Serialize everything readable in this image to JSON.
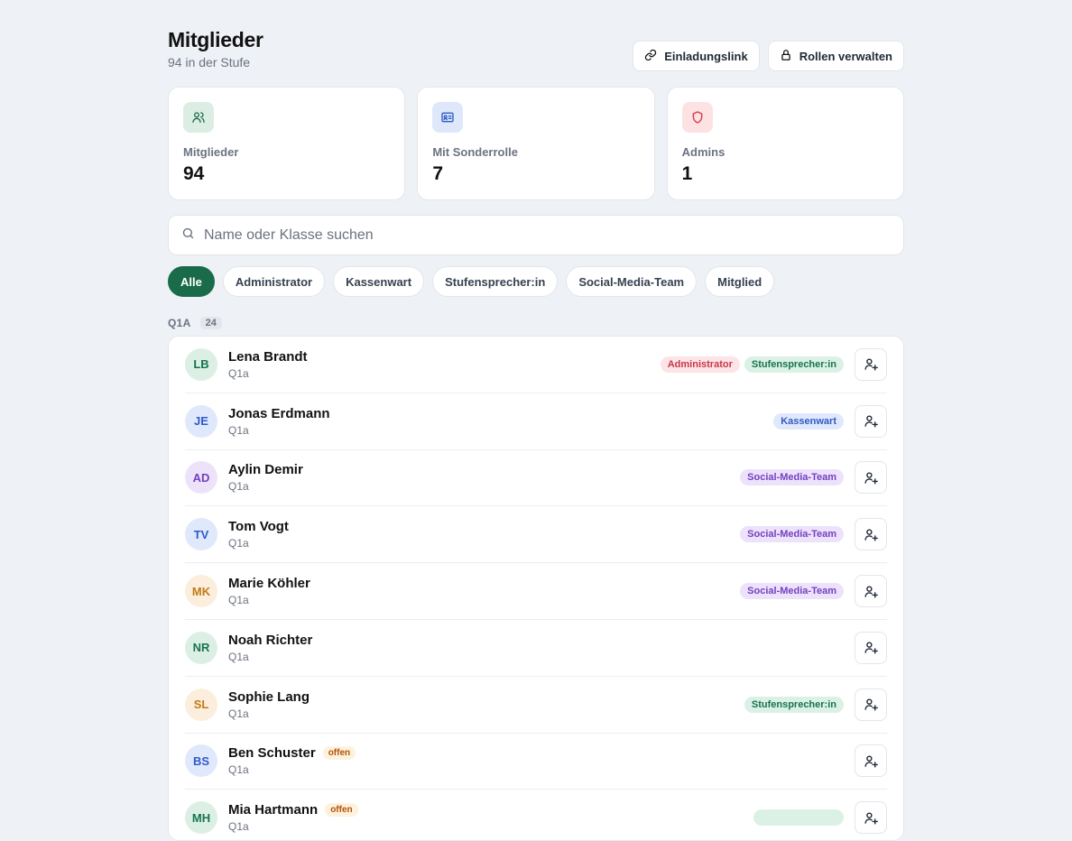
{
  "header": {
    "title": "Mitglieder",
    "subtitle": "94 in der Stufe",
    "invite_label": "Einladungslink",
    "roles_label": "Rollen verwalten"
  },
  "stats": [
    {
      "label": "Mitglieder",
      "value": "94",
      "icon": "users-icon",
      "color": "#1a6b4a",
      "bg": "#dceee4"
    },
    {
      "label": "Mit Sonderrolle",
      "value": "7",
      "icon": "id-card-icon",
      "color": "#2f5bc8",
      "bg": "#dfe7fa"
    },
    {
      "label": "Admins",
      "value": "1",
      "icon": "shield-icon",
      "color": "#d93a4a",
      "bg": "#fde2e4"
    }
  ],
  "search": {
    "placeholder": "Name oder Klasse suchen",
    "value": ""
  },
  "filters": [
    "Alle",
    "Administrator",
    "Kassenwart",
    "Stufensprecher:in",
    "Social-Media-Team",
    "Mitglied"
  ],
  "active_filter": "Alle",
  "group": {
    "name": "Q1A",
    "count": "24"
  },
  "members": [
    {
      "initials": "LB",
      "name": "Lena Brandt",
      "class": "Q1a",
      "status": "",
      "roles": [
        {
          "label": "Administrator",
          "type": "admin"
        },
        {
          "label": "Stufensprecher:in",
          "type": "stuf"
        }
      ],
      "avatar_color": "#17744f",
      "avatar_bg": "#dcefe5"
    },
    {
      "initials": "JE",
      "name": "Jonas Erdmann",
      "class": "Q1a",
      "status": "",
      "roles": [
        {
          "label": "Kassenwart",
          "type": "kasse"
        }
      ],
      "avatar_color": "#2f5bc8",
      "avatar_bg": "#e0e8fb"
    },
    {
      "initials": "AD",
      "name": "Aylin Demir",
      "class": "Q1a",
      "status": "",
      "roles": [
        {
          "label": "Social-Media-Team",
          "type": "smt"
        }
      ],
      "avatar_color": "#7440c0",
      "avatar_bg": "#ece3fa"
    },
    {
      "initials": "TV",
      "name": "Tom Vogt",
      "class": "Q1a",
      "status": "",
      "roles": [
        {
          "label": "Social-Media-Team",
          "type": "smt"
        }
      ],
      "avatar_color": "#2f5bc8",
      "avatar_bg": "#e0e8fb"
    },
    {
      "initials": "MK",
      "name": "Marie Köhler",
      "class": "Q1a",
      "status": "",
      "roles": [
        {
          "label": "Social-Media-Team",
          "type": "smt"
        }
      ],
      "avatar_color": "#c47a16",
      "avatar_bg": "#fbeedd"
    },
    {
      "initials": "NR",
      "name": "Noah Richter",
      "class": "Q1a",
      "status": "",
      "roles": [],
      "avatar_color": "#17744f",
      "avatar_bg": "#dcefe5"
    },
    {
      "initials": "SL",
      "name": "Sophie Lang",
      "class": "Q1a",
      "status": "",
      "roles": [
        {
          "label": "Stufensprecher:in",
          "type": "stuf"
        }
      ],
      "avatar_color": "#c47a16",
      "avatar_bg": "#fbeedd"
    },
    {
      "initials": "BS",
      "name": "Ben Schuster",
      "class": "Q1a",
      "status": "offen",
      "roles": [],
      "avatar_color": "#2f5bc8",
      "avatar_bg": "#e0e8fb"
    },
    {
      "initials": "MH",
      "name": "Mia Hartmann",
      "class": "Q1a",
      "status": "offen",
      "roles": [
        {
          "label": "",
          "type": "stuf"
        }
      ],
      "avatar_color": "#17744f",
      "avatar_bg": "#dcefe5"
    }
  ]
}
